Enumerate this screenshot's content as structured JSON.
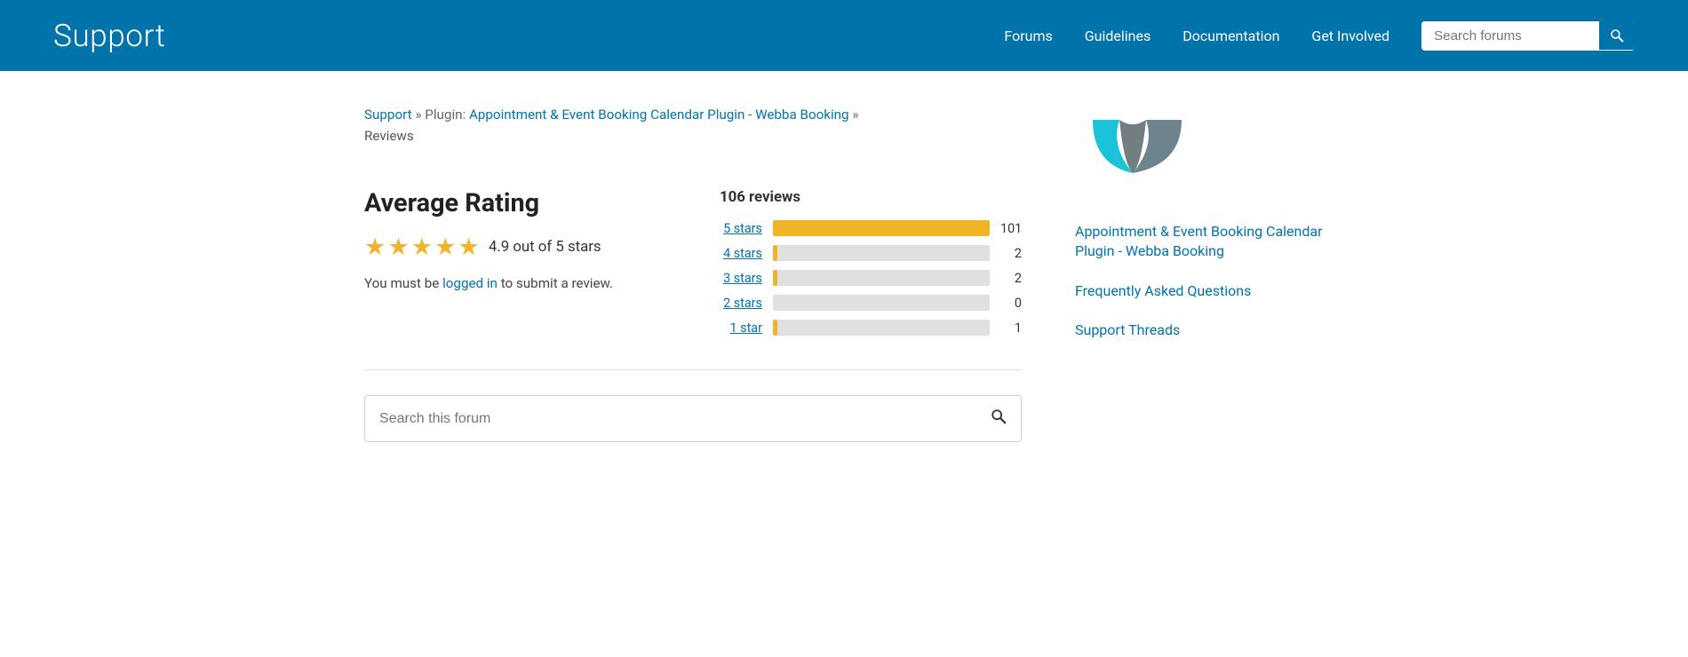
{
  "header": {
    "title": "Support",
    "nav": [
      {
        "label": "Forums",
        "href": "#"
      },
      {
        "label": "Guidelines",
        "href": "#"
      },
      {
        "label": "Documentation",
        "href": "#"
      },
      {
        "label": "Get Involved",
        "href": "#"
      }
    ],
    "search_placeholder": "Search forums"
  },
  "breadcrumb": {
    "support_label": "Support",
    "separator1": " » Plugin: ",
    "plugin_label": "Appointment & Event Booking Calendar Plugin - Webba Booking",
    "separator2": " »",
    "current": "Reviews"
  },
  "rating_section": {
    "heading": "Average Rating",
    "stars_count": 5,
    "rating_text": "4.9 out of 5 stars",
    "login_prompt_prefix": "You must be ",
    "login_link": "logged in",
    "login_prompt_suffix": " to submit a review."
  },
  "reviews": {
    "total": "106 reviews",
    "bars": [
      {
        "label": "5 stars",
        "count": 101,
        "max": 106,
        "pct": 95
      },
      {
        "label": "4 stars",
        "count": 2,
        "max": 106,
        "pct": 4
      },
      {
        "label": "3 stars",
        "count": 2,
        "max": 106,
        "pct": 4
      },
      {
        "label": "2 stars",
        "count": 0,
        "max": 106,
        "pct": 0
      },
      {
        "label": "1 star",
        "count": 1,
        "max": 106,
        "pct": 2
      }
    ]
  },
  "forum_search": {
    "placeholder": "Search this forum"
  },
  "sidebar": {
    "plugin_link": "Appointment & Event Booking Calendar Plugin - Webba Booking",
    "faq_link": "Frequently Asked Questions",
    "support_link": "Support Threads"
  }
}
